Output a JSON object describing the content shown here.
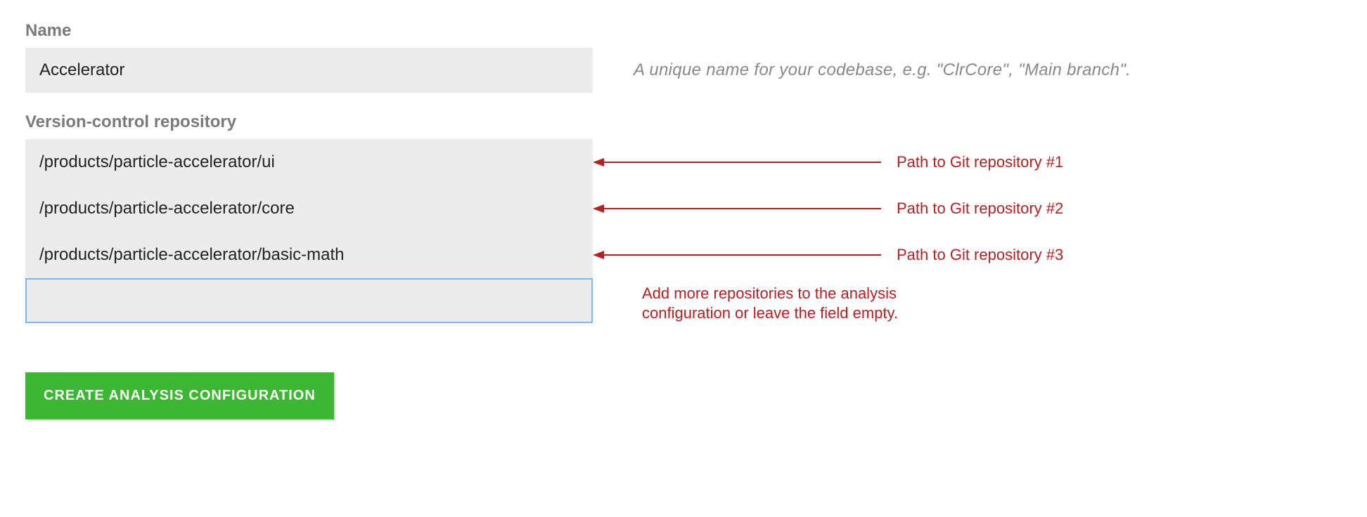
{
  "name_section": {
    "label": "Name",
    "value": "Accelerator",
    "hint": "A unique name for your codebase, e.g. \"ClrCore\", \"Main branch\"."
  },
  "repo_section": {
    "label": "Version-control repository",
    "rows": [
      {
        "value": "/products/particle-accelerator/ui",
        "annotation": "Path to Git repository #1"
      },
      {
        "value": "/products/particle-accelerator/core",
        "annotation": "Path to Git repository #2"
      },
      {
        "value": "/products/particle-accelerator/basic-math",
        "annotation": "Path to Git repository #3"
      }
    ],
    "blank_annotation": "Add more repositories to the analysis configuration or leave the field empty."
  },
  "button": {
    "label": "CREATE ANALYSIS CONFIGURATION"
  },
  "colors": {
    "annotation": "#b72020",
    "button_bg": "#3db733",
    "input_bg": "#ececec",
    "focus_border": "#7db7e8"
  }
}
